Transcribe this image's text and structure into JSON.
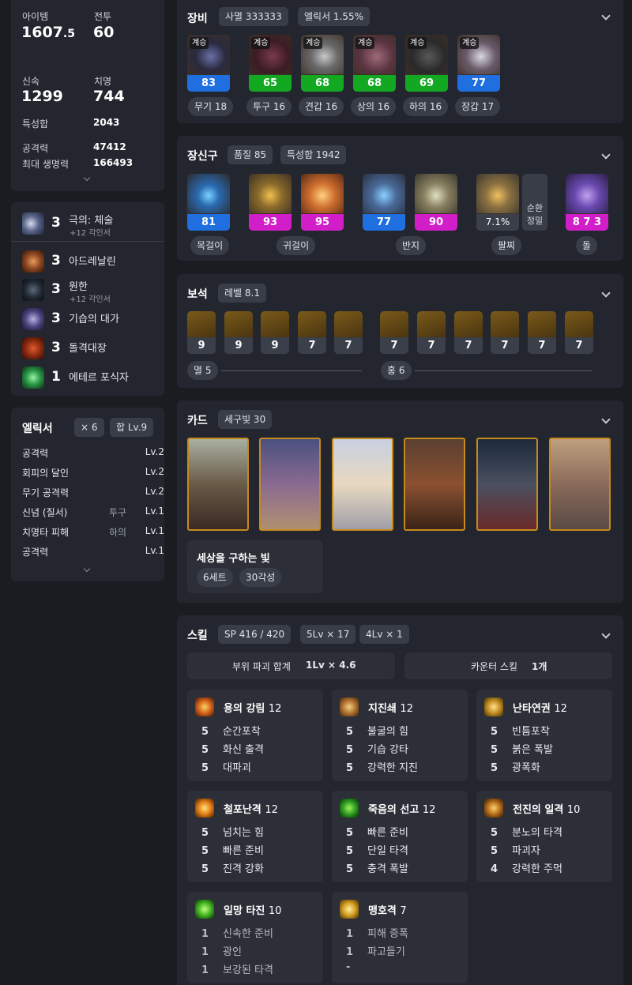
{
  "stats": {
    "item_level_label": "아이템",
    "item_level_int": "1607",
    "item_level_dec": ".5",
    "combat_label": "전투",
    "combat_value": "60",
    "swift_label": "신속",
    "swift_value": "1299",
    "crit_label": "치명",
    "crit_value": "744",
    "spec_total_label": "특성합",
    "spec_total_value": "2043",
    "attack_label": "공격력",
    "attack_value": "47412",
    "hp_label": "최대 생명력",
    "hp_value": "166493"
  },
  "engravings": [
    {
      "level": "3",
      "name": "극의: 체술",
      "sub": "+12 각인서"
    },
    {
      "level": "3",
      "name": "아드레날린",
      "sub": ""
    },
    {
      "level": "3",
      "name": "원한",
      "sub": "+12 각인서"
    },
    {
      "level": "3",
      "name": "기습의 대가",
      "sub": ""
    },
    {
      "level": "3",
      "name": "돌격대장",
      "sub": ""
    },
    {
      "level": "1",
      "name": "에테르 포식자",
      "sub": ""
    }
  ],
  "elixir": {
    "title": "엘릭서",
    "count": "× 6",
    "total": "합 Lv.9",
    "rows": [
      {
        "name": "공격력",
        "slot": "",
        "level": "Lv.2"
      },
      {
        "name": "회피의 달인",
        "slot": "",
        "level": "Lv.2"
      },
      {
        "name": "무기 공격력",
        "slot": "",
        "level": "Lv.2"
      },
      {
        "name": "신념 (질서)",
        "slot": "투구",
        "level": "Lv.1"
      },
      {
        "name": "치명타 피해",
        "slot": "하의",
        "level": "Lv.1"
      },
      {
        "name": "공격력",
        "slot": "",
        "level": "Lv.1"
      }
    ]
  },
  "equipment": {
    "title": "장비",
    "chip1": "사멸 333333",
    "chip2": "엘릭서 1.55%",
    "items": [
      {
        "tag": "계승",
        "quality": "83",
        "label": "무기 18",
        "color": "#1f6fe0"
      },
      {
        "tag": "계승",
        "quality": "65",
        "label": "투구 16",
        "color": "#13a822"
      },
      {
        "tag": "계승",
        "quality": "68",
        "label": "견갑 16",
        "color": "#13a822"
      },
      {
        "tag": "계승",
        "quality": "68",
        "label": "상의 16",
        "color": "#13a822"
      },
      {
        "tag": "계승",
        "quality": "69",
        "label": "하의 16",
        "color": "#13a822"
      },
      {
        "tag": "계승",
        "quality": "77",
        "label": "장갑 17",
        "color": "#1f6fe0"
      }
    ]
  },
  "accessories": {
    "title": "장신구",
    "chip1": "품질 85",
    "chip2": "특성합 1942",
    "items": [
      {
        "quality": "81",
        "color": "#1f6fe0"
      },
      {
        "quality": "93",
        "color": "#d21ec8"
      },
      {
        "quality": "95",
        "color": "#d21ec8"
      },
      {
        "quality": "77",
        "color": "#1f6fe0"
      },
      {
        "quality": "90",
        "color": "#d21ec8"
      },
      {
        "quality": "7.1%",
        "color": "#3b3f49"
      },
      {
        "quality": "8 7 3",
        "color": "#d21ec8"
      }
    ],
    "circulation_1": "순환",
    "circulation_2": "정밀",
    "labels": [
      "목걸이",
      "귀걸이",
      "반지",
      "팔찌",
      "돌"
    ]
  },
  "gems": {
    "title": "보석",
    "chip": "레벨 8.1",
    "left_values": [
      "9",
      "9",
      "9",
      "7",
      "7"
    ],
    "right_values": [
      "7",
      "7",
      "7",
      "7",
      "7",
      "7"
    ],
    "left_label": "멸 5",
    "right_label": "홍 6"
  },
  "cards": {
    "title": "카드",
    "chip": "세구빛 30",
    "set_name": "세상을 구하는 빛",
    "set_chip1": "6세트",
    "set_chip2": "30각성"
  },
  "skills": {
    "title": "스킬",
    "chip1": "SP 416 / 420",
    "chip2": "5Lv × 17",
    "chip3": "4Lv × 1",
    "part_break_label": "부위 파괴 합계",
    "part_break_value": "1Lv × 4.6",
    "counter_label": "카운터 스킬",
    "counter_value": "1개",
    "list": [
      {
        "name": "용의 강림",
        "level": "12",
        "tripods": [
          [
            "5",
            "순간포착"
          ],
          [
            "5",
            "화신 출격"
          ],
          [
            "5",
            "대파괴"
          ]
        ]
      },
      {
        "name": "지진쇄",
        "level": "12",
        "tripods": [
          [
            "5",
            "불굴의 힘"
          ],
          [
            "5",
            "기습 강타"
          ],
          [
            "5",
            "강력한 지진"
          ]
        ]
      },
      {
        "name": "난타연권",
        "level": "12",
        "tripods": [
          [
            "5",
            "빈틈포착"
          ],
          [
            "5",
            "붉은 폭발"
          ],
          [
            "5",
            "광폭화"
          ]
        ]
      },
      {
        "name": "철포난격",
        "level": "12",
        "tripods": [
          [
            "5",
            "넘치는 힘"
          ],
          [
            "5",
            "빠른 준비"
          ],
          [
            "5",
            "진격 강화"
          ]
        ]
      },
      {
        "name": "죽음의 선고",
        "level": "12",
        "tripods": [
          [
            "5",
            "빠른 준비"
          ],
          [
            "5",
            "단일 타격"
          ],
          [
            "5",
            "충격 폭발"
          ]
        ]
      },
      {
        "name": "전진의 일격",
        "level": "10",
        "tripods": [
          [
            "5",
            "분노의 타격"
          ],
          [
            "5",
            "파괴자"
          ],
          [
            "4",
            "강력한 주먹"
          ]
        ]
      },
      {
        "name": "일망 타진",
        "level": "10",
        "tripods": [
          [
            "1",
            "신속한 준비"
          ],
          [
            "1",
            "광인"
          ],
          [
            "1",
            "보강된 타격"
          ]
        ]
      },
      {
        "name": "맹호격",
        "level": "7",
        "tripods": [
          [
            "1",
            "피해 증폭"
          ],
          [
            "1",
            "파고들기"
          ],
          [
            "-",
            ""
          ]
        ]
      }
    ]
  }
}
